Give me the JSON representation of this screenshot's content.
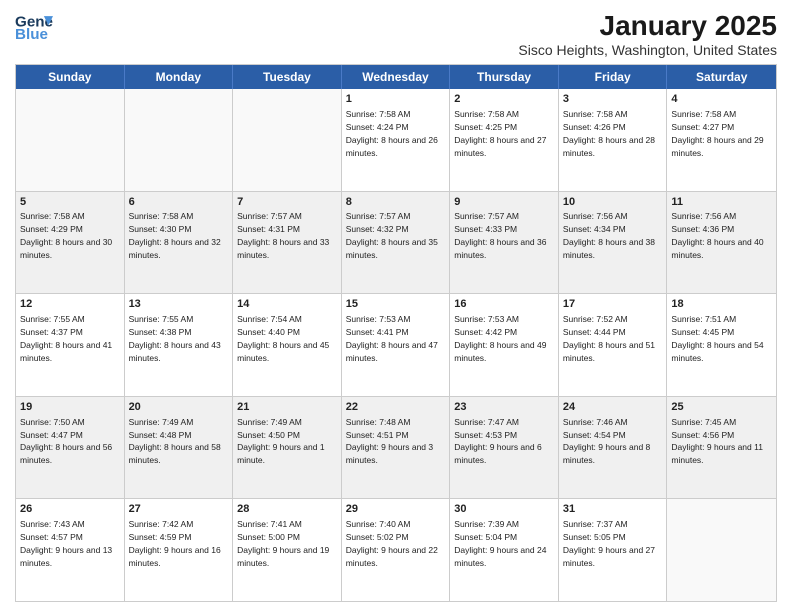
{
  "logo": {
    "line1": "General",
    "line2": "Blue"
  },
  "title": "January 2025",
  "subtitle": "Sisco Heights, Washington, United States",
  "days_of_week": [
    "Sunday",
    "Monday",
    "Tuesday",
    "Wednesday",
    "Thursday",
    "Friday",
    "Saturday"
  ],
  "weeks": [
    [
      {
        "day": "",
        "text": "",
        "shaded": false,
        "empty": true
      },
      {
        "day": "",
        "text": "",
        "shaded": false,
        "empty": true
      },
      {
        "day": "",
        "text": "",
        "shaded": false,
        "empty": true
      },
      {
        "day": "1",
        "text": "Sunrise: 7:58 AM\nSunset: 4:24 PM\nDaylight: 8 hours and 26 minutes.",
        "shaded": false,
        "empty": false
      },
      {
        "day": "2",
        "text": "Sunrise: 7:58 AM\nSunset: 4:25 PM\nDaylight: 8 hours and 27 minutes.",
        "shaded": false,
        "empty": false
      },
      {
        "day": "3",
        "text": "Sunrise: 7:58 AM\nSunset: 4:26 PM\nDaylight: 8 hours and 28 minutes.",
        "shaded": false,
        "empty": false
      },
      {
        "day": "4",
        "text": "Sunrise: 7:58 AM\nSunset: 4:27 PM\nDaylight: 8 hours and 29 minutes.",
        "shaded": false,
        "empty": false
      }
    ],
    [
      {
        "day": "5",
        "text": "Sunrise: 7:58 AM\nSunset: 4:29 PM\nDaylight: 8 hours and 30 minutes.",
        "shaded": true,
        "empty": false
      },
      {
        "day": "6",
        "text": "Sunrise: 7:58 AM\nSunset: 4:30 PM\nDaylight: 8 hours and 32 minutes.",
        "shaded": true,
        "empty": false
      },
      {
        "day": "7",
        "text": "Sunrise: 7:57 AM\nSunset: 4:31 PM\nDaylight: 8 hours and 33 minutes.",
        "shaded": true,
        "empty": false
      },
      {
        "day": "8",
        "text": "Sunrise: 7:57 AM\nSunset: 4:32 PM\nDaylight: 8 hours and 35 minutes.",
        "shaded": true,
        "empty": false
      },
      {
        "day": "9",
        "text": "Sunrise: 7:57 AM\nSunset: 4:33 PM\nDaylight: 8 hours and 36 minutes.",
        "shaded": true,
        "empty": false
      },
      {
        "day": "10",
        "text": "Sunrise: 7:56 AM\nSunset: 4:34 PM\nDaylight: 8 hours and 38 minutes.",
        "shaded": true,
        "empty": false
      },
      {
        "day": "11",
        "text": "Sunrise: 7:56 AM\nSunset: 4:36 PM\nDaylight: 8 hours and 40 minutes.",
        "shaded": true,
        "empty": false
      }
    ],
    [
      {
        "day": "12",
        "text": "Sunrise: 7:55 AM\nSunset: 4:37 PM\nDaylight: 8 hours and 41 minutes.",
        "shaded": false,
        "empty": false
      },
      {
        "day": "13",
        "text": "Sunrise: 7:55 AM\nSunset: 4:38 PM\nDaylight: 8 hours and 43 minutes.",
        "shaded": false,
        "empty": false
      },
      {
        "day": "14",
        "text": "Sunrise: 7:54 AM\nSunset: 4:40 PM\nDaylight: 8 hours and 45 minutes.",
        "shaded": false,
        "empty": false
      },
      {
        "day": "15",
        "text": "Sunrise: 7:53 AM\nSunset: 4:41 PM\nDaylight: 8 hours and 47 minutes.",
        "shaded": false,
        "empty": false
      },
      {
        "day": "16",
        "text": "Sunrise: 7:53 AM\nSunset: 4:42 PM\nDaylight: 8 hours and 49 minutes.",
        "shaded": false,
        "empty": false
      },
      {
        "day": "17",
        "text": "Sunrise: 7:52 AM\nSunset: 4:44 PM\nDaylight: 8 hours and 51 minutes.",
        "shaded": false,
        "empty": false
      },
      {
        "day": "18",
        "text": "Sunrise: 7:51 AM\nSunset: 4:45 PM\nDaylight: 8 hours and 54 minutes.",
        "shaded": false,
        "empty": false
      }
    ],
    [
      {
        "day": "19",
        "text": "Sunrise: 7:50 AM\nSunset: 4:47 PM\nDaylight: 8 hours and 56 minutes.",
        "shaded": true,
        "empty": false
      },
      {
        "day": "20",
        "text": "Sunrise: 7:49 AM\nSunset: 4:48 PM\nDaylight: 8 hours and 58 minutes.",
        "shaded": true,
        "empty": false
      },
      {
        "day": "21",
        "text": "Sunrise: 7:49 AM\nSunset: 4:50 PM\nDaylight: 9 hours and 1 minute.",
        "shaded": true,
        "empty": false
      },
      {
        "day": "22",
        "text": "Sunrise: 7:48 AM\nSunset: 4:51 PM\nDaylight: 9 hours and 3 minutes.",
        "shaded": true,
        "empty": false
      },
      {
        "day": "23",
        "text": "Sunrise: 7:47 AM\nSunset: 4:53 PM\nDaylight: 9 hours and 6 minutes.",
        "shaded": true,
        "empty": false
      },
      {
        "day": "24",
        "text": "Sunrise: 7:46 AM\nSunset: 4:54 PM\nDaylight: 9 hours and 8 minutes.",
        "shaded": true,
        "empty": false
      },
      {
        "day": "25",
        "text": "Sunrise: 7:45 AM\nSunset: 4:56 PM\nDaylight: 9 hours and 11 minutes.",
        "shaded": true,
        "empty": false
      }
    ],
    [
      {
        "day": "26",
        "text": "Sunrise: 7:43 AM\nSunset: 4:57 PM\nDaylight: 9 hours and 13 minutes.",
        "shaded": false,
        "empty": false
      },
      {
        "day": "27",
        "text": "Sunrise: 7:42 AM\nSunset: 4:59 PM\nDaylight: 9 hours and 16 minutes.",
        "shaded": false,
        "empty": false
      },
      {
        "day": "28",
        "text": "Sunrise: 7:41 AM\nSunset: 5:00 PM\nDaylight: 9 hours and 19 minutes.",
        "shaded": false,
        "empty": false
      },
      {
        "day": "29",
        "text": "Sunrise: 7:40 AM\nSunset: 5:02 PM\nDaylight: 9 hours and 22 minutes.",
        "shaded": false,
        "empty": false
      },
      {
        "day": "30",
        "text": "Sunrise: 7:39 AM\nSunset: 5:04 PM\nDaylight: 9 hours and 24 minutes.",
        "shaded": false,
        "empty": false
      },
      {
        "day": "31",
        "text": "Sunrise: 7:37 AM\nSunset: 5:05 PM\nDaylight: 9 hours and 27 minutes.",
        "shaded": false,
        "empty": false
      },
      {
        "day": "",
        "text": "",
        "shaded": false,
        "empty": true
      }
    ]
  ]
}
